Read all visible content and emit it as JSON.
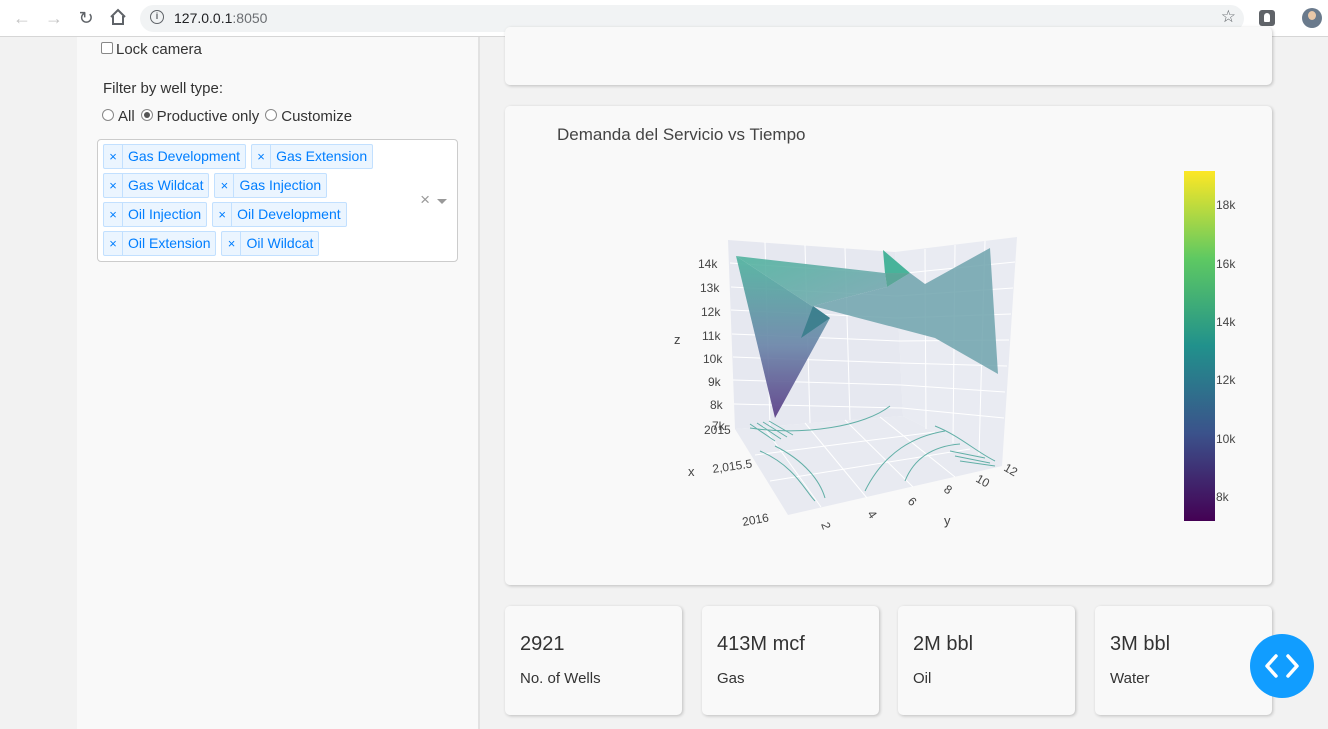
{
  "browser": {
    "url_host": "127.0.0.1",
    "url_port": ":8050"
  },
  "sidebar": {
    "lock_camera_label": "Lock camera",
    "filter_label": "Filter by well type:",
    "radio_options": [
      "All",
      "Productive only",
      "Customize"
    ],
    "radio_selected": "Productive only",
    "well_types": [
      "Gas Development",
      "Gas Extension",
      "Gas Wildcat",
      "Gas Injection",
      "Oil Injection",
      "Oil Development",
      "Oil Extension",
      "Oil Wildcat"
    ]
  },
  "chart": {
    "title": "Demanda del Servicio vs Tiempo",
    "z_label": "z",
    "x_label": "x",
    "y_label": "y",
    "z_ticks": [
      "14k",
      "13k",
      "12k",
      "11k",
      "10k",
      "9k",
      "8k",
      "7k"
    ],
    "x_ticks": [
      "2015",
      "2,015.5",
      "2016"
    ],
    "y_ticks": [
      "2",
      "4",
      "6",
      "8",
      "10",
      "12"
    ],
    "colorbar_ticks": [
      "18k",
      "16k",
      "14k",
      "12k",
      "10k",
      "8k"
    ],
    "colorscale": "viridis",
    "accent_colors": [
      "#440154",
      "#3b528b",
      "#21918c",
      "#5ec962",
      "#fde725"
    ]
  },
  "chart_data": {
    "type": "surface3d",
    "title": "Demanda del Servicio vs Tiempo",
    "xlabel": "x",
    "ylabel": "y",
    "zlabel": "z",
    "x_range": [
      2015,
      2016
    ],
    "y_range": [
      1,
      12
    ],
    "z_range": [
      7000,
      14000
    ],
    "colorbar_range": [
      7000,
      19000
    ],
    "colorscale": "Viridis",
    "contours_projected_on_floor": true
  },
  "stats": [
    {
      "value": "2921",
      "label": "No. of Wells"
    },
    {
      "value": "413M mcf",
      "label": "Gas"
    },
    {
      "value": "2M bbl",
      "label": "Oil"
    },
    {
      "value": "3M bbl",
      "label": "Water"
    }
  ]
}
